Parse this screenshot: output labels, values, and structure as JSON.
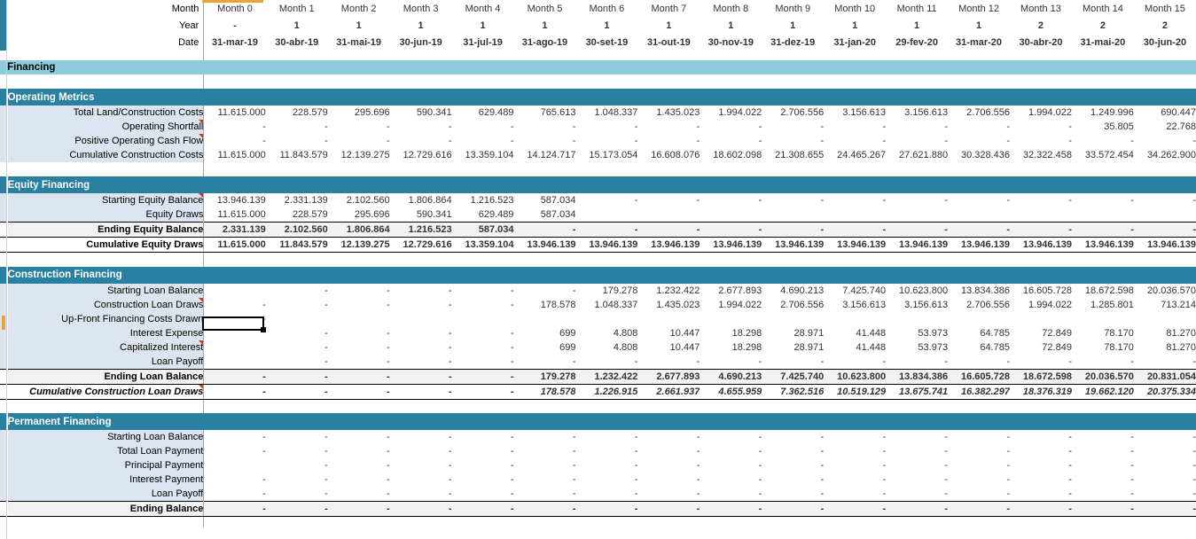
{
  "header": {
    "row_labels": [
      "Month",
      "Year",
      "Date"
    ],
    "months": [
      "Month 0",
      "Month 1",
      "Month 2",
      "Month 3",
      "Month 4",
      "Month 5",
      "Month 6",
      "Month 7",
      "Month 8",
      "Month 9",
      "Month 10",
      "Month 11",
      "Month 12",
      "Month 13",
      "Month 14",
      "Month 15"
    ],
    "years": [
      "-",
      "1",
      "1",
      "1",
      "1",
      "1",
      "1",
      "1",
      "1",
      "1",
      "1",
      "1",
      "1",
      "2",
      "2",
      "2"
    ],
    "dates": [
      "31-mar-19",
      "30-abr-19",
      "31-mai-19",
      "30-jun-19",
      "31-jul-19",
      "31-ago-19",
      "30-set-19",
      "31-out-19",
      "30-nov-19",
      "31-dez-19",
      "31-jan-20",
      "29-fev-20",
      "31-mar-20",
      "30-abr-20",
      "31-mai-20",
      "30-jun-20"
    ]
  },
  "colors": {
    "band_dark": "#2980a0",
    "band_light": "#8ecadd",
    "shade": "#dbe4ef",
    "marker_orange": "#e8a33d",
    "comment_red": "#c0392b"
  },
  "sections": {
    "financing": {
      "title": "Financing"
    },
    "operating_metrics": {
      "title": "Operating Metrics",
      "rows": [
        {
          "label": "Total Land/Construction Costs",
          "comment": false,
          "values": [
            "11.615.000",
            "228.579",
            "295.696",
            "590.341",
            "629.489",
            "765.613",
            "1.048.337",
            "1.435.023",
            "1.994.022",
            "2.706.556",
            "3.156.613",
            "3.156.613",
            "2.706.556",
            "1.994.022",
            "1.249.996",
            "690.447"
          ]
        },
        {
          "label": "Operating Shortfall",
          "comment": true,
          "values": [
            "-",
            "-",
            "-",
            "-",
            "-",
            "-",
            "-",
            "-",
            "-",
            "-",
            "-",
            "-",
            "-",
            "-",
            "35.805",
            "22.768"
          ]
        },
        {
          "label": "Positive Operating Cash Flow",
          "comment": true,
          "values": [
            "-",
            "-",
            "-",
            "-",
            "-",
            "-",
            "-",
            "-",
            "-",
            "-",
            "-",
            "-",
            "-",
            "-",
            "-",
            "-"
          ]
        },
        {
          "label": "Cumulative Construction Costs",
          "comment": false,
          "values": [
            "11.615.000",
            "11.843.579",
            "12.139.275",
            "12.729.616",
            "13.359.104",
            "14.124.717",
            "15.173.054",
            "16.608.076",
            "18.602.098",
            "21.308.655",
            "24.465.267",
            "27.621.880",
            "30.328.436",
            "32.322.458",
            "33.572.454",
            "34.262.900"
          ]
        }
      ]
    },
    "equity_financing": {
      "title": "Equity Financing",
      "rows": [
        {
          "label": "Starting Equity Balance",
          "comment": true,
          "style": "normal",
          "values": [
            "13.946.139",
            "2.331.139",
            "2.102.560",
            "1.806.864",
            "1.216.523",
            "587.034",
            "-",
            "-",
            "-",
            "-",
            "-",
            "-",
            "-",
            "-",
            "-",
            "-"
          ]
        },
        {
          "label": "Equity Draws",
          "comment": false,
          "style": "normal",
          "values": [
            "11.615.000",
            "228.579",
            "295.696",
            "590.341",
            "629.489",
            "587.034",
            "",
            "",
            "",
            "",
            "",
            "",
            "",
            "",
            "",
            ""
          ]
        },
        {
          "label": "Ending Equity Balance",
          "comment": false,
          "style": "total",
          "values": [
            "2.331.139",
            "2.102.560",
            "1.806.864",
            "1.216.523",
            "587.034",
            "-",
            "-",
            "-",
            "-",
            "-",
            "-",
            "-",
            "-",
            "-",
            "-",
            "-"
          ]
        },
        {
          "label": "Cumulative Equity Draws",
          "comment": false,
          "style": "total2",
          "values": [
            "11.615.000",
            "11.843.579",
            "12.139.275",
            "12.729.616",
            "13.359.104",
            "13.946.139",
            "13.946.139",
            "13.946.139",
            "13.946.139",
            "13.946.139",
            "13.946.139",
            "13.946.139",
            "13.946.139",
            "13.946.139",
            "13.946.139",
            "13.946.139"
          ]
        }
      ]
    },
    "construction_financing": {
      "title": "Construction Financing",
      "rows": [
        {
          "label": "Starting Loan Balance",
          "comment": false,
          "style": "normal",
          "values": [
            "",
            "-",
            "-",
            "-",
            "-",
            "-",
            "179.278",
            "1.232.422",
            "2.677.893",
            "4.690.213",
            "7.425.740",
            "10.623.800",
            "13.834.386",
            "16.605.728",
            "18.672.598",
            "20.036.570"
          ]
        },
        {
          "label": "Construction Loan Draws",
          "comment": true,
          "style": "normal",
          "values": [
            "-",
            "-",
            "-",
            "-",
            "-",
            "178.578",
            "1.048.337",
            "1.435.023",
            "1.994.022",
            "2.706.556",
            "3.156.613",
            "3.156.613",
            "2.706.556",
            "1.994.022",
            "1.285.801",
            "713.214"
          ]
        },
        {
          "label": "Up-Front Financing Costs Drawn",
          "comment": false,
          "style": "normal",
          "values": [
            "-",
            "",
            "",
            "",
            "",
            "",
            "",
            "",
            "",
            "",
            "",
            "",
            "",
            "",
            "",
            ""
          ]
        },
        {
          "label": "Interest Expense",
          "comment": false,
          "style": "normal",
          "values": [
            "",
            "-",
            "-",
            "-",
            "-",
            "699",
            "4.808",
            "10.447",
            "18.298",
            "28.971",
            "41.448",
            "53.973",
            "64.785",
            "72.849",
            "78.170",
            "81.270"
          ]
        },
        {
          "label": "Capitalized Interest",
          "comment": true,
          "style": "normal",
          "values": [
            "",
            "-",
            "-",
            "-",
            "-",
            "699",
            "4.808",
            "10.447",
            "18.298",
            "28.971",
            "41.448",
            "53.973",
            "64.785",
            "72.849",
            "78.170",
            "81.270"
          ]
        },
        {
          "label": "Loan Payoff",
          "comment": false,
          "style": "normal",
          "values": [
            "",
            "-",
            "-",
            "-",
            "-",
            "-",
            "-",
            "-",
            "-",
            "-",
            "-",
            "-",
            "-",
            "-",
            "-",
            "-"
          ]
        },
        {
          "label": "Ending Loan Balance",
          "comment": false,
          "style": "total",
          "values": [
            "-",
            "-",
            "-",
            "-",
            "-",
            "179.278",
            "1.232.422",
            "2.677.893",
            "4.690.213",
            "7.425.740",
            "10.623.800",
            "13.834.386",
            "16.605.728",
            "18.672.598",
            "20.036.570",
            "20.831.054"
          ]
        },
        {
          "label": "Cumulative Construction Loan Draws",
          "comment": true,
          "style": "total2ital",
          "values": [
            "-",
            "-",
            "-",
            "-",
            "-",
            "178.578",
            "1.226.915",
            "2.661.937",
            "4.655.959",
            "7.362.516",
            "10.519.129",
            "13.675.741",
            "16.382.297",
            "18.376.319",
            "19.662.120",
            "20.375.334"
          ]
        }
      ]
    },
    "permanent_financing": {
      "title": "Permanent Financing",
      "rows": [
        {
          "label": "Starting Loan Balance",
          "comment": false,
          "style": "normal",
          "values": [
            "-",
            "-",
            "-",
            "-",
            "-",
            "-",
            "-",
            "-",
            "-",
            "-",
            "-",
            "-",
            "-",
            "-",
            "-",
            "-"
          ]
        },
        {
          "label": "Total Loan Payment",
          "comment": false,
          "style": "normal",
          "values": [
            "-",
            "-",
            "-",
            "-",
            "-",
            "-",
            "-",
            "-",
            "-",
            "-",
            "-",
            "-",
            "-",
            "-",
            "-",
            "-"
          ]
        },
        {
          "label": "Principal Payment",
          "comment": false,
          "style": "normal",
          "values": [
            "",
            "-",
            "-",
            "-",
            "-",
            "-",
            "-",
            "-",
            "-",
            "-",
            "-",
            "-",
            "-",
            "-",
            "-",
            "-"
          ]
        },
        {
          "label": "Interest Payment",
          "comment": false,
          "style": "normal",
          "values": [
            "-",
            "-",
            "-",
            "-",
            "-",
            "-",
            "-",
            "-",
            "-",
            "-",
            "-",
            "-",
            "-",
            "-",
            "-",
            "-"
          ]
        },
        {
          "label": "Loan Payoff",
          "comment": false,
          "style": "normal",
          "values": [
            "-",
            "-",
            "-",
            "-",
            "-",
            "-",
            "-",
            "-",
            "-",
            "-",
            "-",
            "-",
            "-",
            "-",
            "-",
            "-"
          ]
        },
        {
          "label": "Ending Balance",
          "comment": false,
          "style": "total",
          "values": [
            "-",
            "-",
            "-",
            "-",
            "-",
            "-",
            "-",
            "-",
            "-",
            "-",
            "-",
            "-",
            "-",
            "-",
            "-",
            "-"
          ]
        }
      ]
    }
  },
  "selection": {
    "cell_row_label": "Up-Front Financing Costs Drawn",
    "cell_column": "Month 0",
    "cell_value": "-"
  }
}
